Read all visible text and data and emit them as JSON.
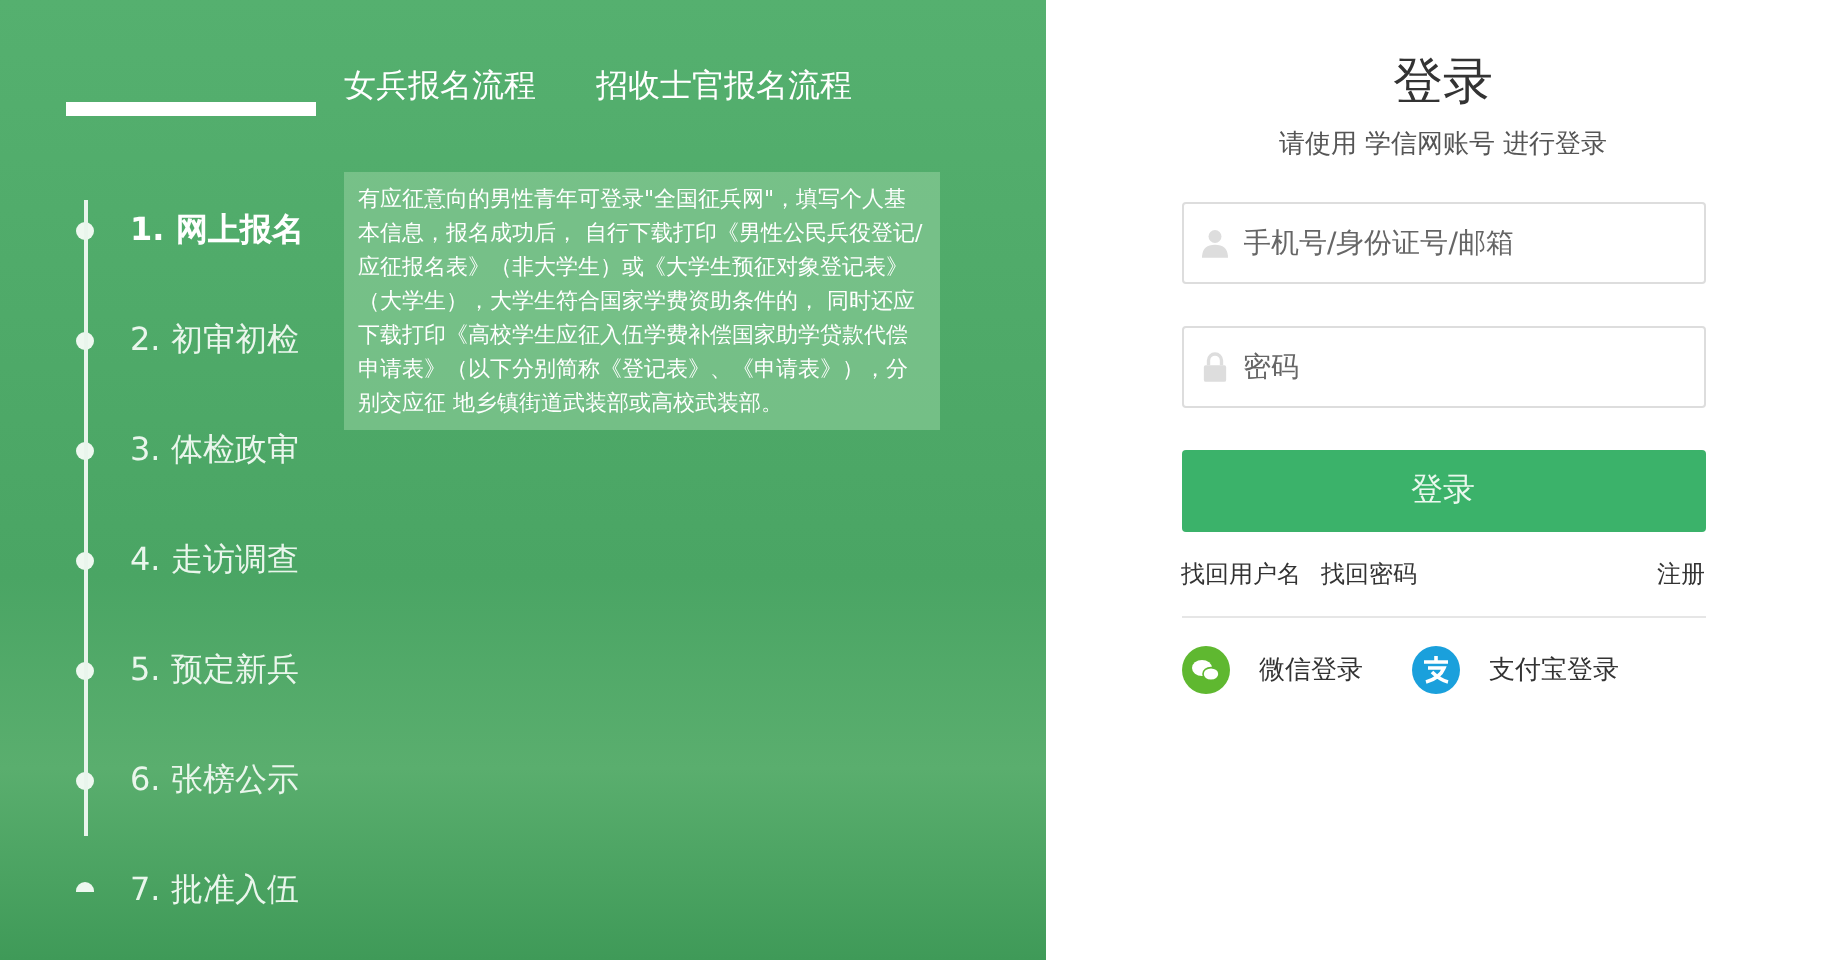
{
  "process_tabs": [
    {
      "label": "女兵报名流程"
    },
    {
      "label": "招收士官报名流程"
    }
  ],
  "steps": [
    {
      "label": "1. 网上报名",
      "selected": true
    },
    {
      "label": "2. 初审初检",
      "selected": false
    },
    {
      "label": "3. 体检政审",
      "selected": false
    },
    {
      "label": "4. 走访调查",
      "selected": false
    },
    {
      "label": "5. 预定新兵",
      "selected": false
    },
    {
      "label": "6. 张榜公示",
      "selected": false
    },
    {
      "label": "7. 批准入伍",
      "selected": false
    }
  ],
  "step_detail": "有应征意向的男性青年可登录\"全国征兵网\"，填写个人基本信息，报名成功后， 自行下载打印《男性公民兵役登记/应征报名表》（非大学生）或《大学生预征对象登记表》（大学生），大学生符合国家学费资助条件的， 同时还应下载打印《高校学生应征入伍学费补偿国家助学贷款代偿申请表》（以下分别简称《登记表》、《申请表》），分别交应征 地乡镇街道武装部或高校武装部。",
  "login": {
    "title": "登录",
    "subtitle": "请使用 学信网账号 进行登录",
    "fields": [
      {
        "kind": "user",
        "placeholder": "手机号/身份证号/邮箱"
      },
      {
        "kind": "password",
        "placeholder": "密码"
      }
    ],
    "submit": "登录",
    "links": [
      "找回用户名",
      "找回密码"
    ],
    "register": "注册",
    "social": [
      {
        "kind": "wechat",
        "label": "微信登录"
      },
      {
        "kind": "alipay",
        "label": "支付宝登录"
      }
    ]
  }
}
